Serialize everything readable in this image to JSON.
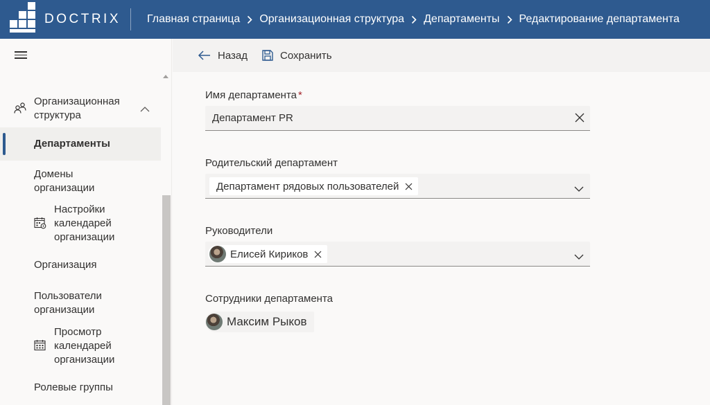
{
  "app": {
    "brand": "DOCTRIX"
  },
  "breadcrumb": [
    "Главная страница",
    "Организационная структура",
    "Департаменты",
    "Редактирование департамента"
  ],
  "sidebar": {
    "group": {
      "label": "Организационная структура",
      "icon": "org-structure-icon",
      "expanded": true
    },
    "items": [
      {
        "label": "Департаменты",
        "active": true
      },
      {
        "label": "Домены организации"
      },
      {
        "label": "Настройки календарей организации",
        "icon": "calendar-settings-icon"
      },
      {
        "label": "Организация"
      },
      {
        "label": "Пользователи организации"
      },
      {
        "label": "Просмотр календарей организации",
        "icon": "calendar-icon"
      },
      {
        "label": "Ролевые группы"
      }
    ]
  },
  "commands": {
    "back": "Назад",
    "save": "Сохранить"
  },
  "form": {
    "name": {
      "label": "Имя департамента",
      "required_mark": "*",
      "value": "Департамент PR"
    },
    "parent": {
      "label": "Родительский департамент",
      "selected": "Департамент рядовых пользователей"
    },
    "managers": {
      "label": "Руководители",
      "selected": "Елисей Кириков"
    },
    "employees": {
      "label": "Сотрудники департамента",
      "items": [
        "Максим Рыков"
      ]
    }
  },
  "colors": {
    "header": "#2e5a8f",
    "accent": "#2e5a8f"
  }
}
